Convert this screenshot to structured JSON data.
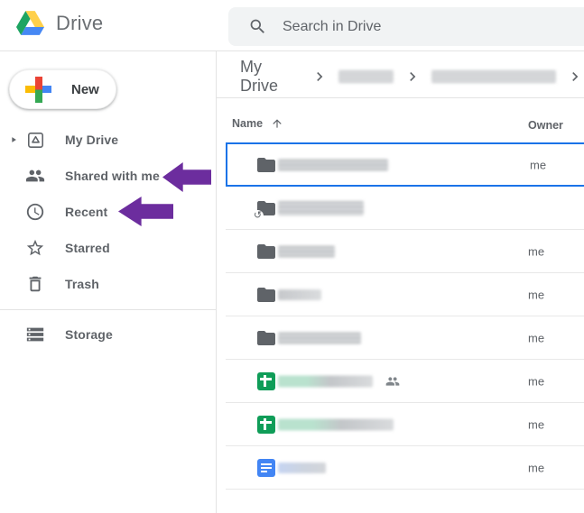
{
  "header": {
    "app_name": "Drive",
    "search": {
      "placeholder": "Search in Drive"
    }
  },
  "sidebar": {
    "new_button_label": "New",
    "items": [
      {
        "label": "My Drive",
        "icon": "my-drive-icon",
        "expandable": true
      },
      {
        "label": "Shared with me",
        "icon": "people-icon"
      },
      {
        "label": "Recent",
        "icon": "clock-icon"
      },
      {
        "label": "Starred",
        "icon": "star-icon"
      },
      {
        "label": "Trash",
        "icon": "trash-icon"
      }
    ],
    "storage_label": "Storage"
  },
  "breadcrumb": {
    "root": "My Drive",
    "redacted_segment_count": 2
  },
  "table": {
    "name_header": "Name",
    "owner_header": "Owner",
    "sort_direction": "ascending",
    "rows": [
      {
        "type": "folder",
        "owner": "me",
        "selected": true,
        "redacted_name_width": 122,
        "blur_style": "streak"
      },
      {
        "type": "folder",
        "owner": "",
        "syncing": true,
        "redacted_name_width": 95,
        "blur_style": "streak-tall"
      },
      {
        "type": "folder",
        "owner": "me",
        "redacted_name_width": 63,
        "blur_style": "streak"
      },
      {
        "type": "folder",
        "owner": "me",
        "redacted_name_width": 48,
        "blur_style": "soft"
      },
      {
        "type": "folder",
        "owner": "me",
        "redacted_name_width": 92,
        "blur_style": "streak"
      },
      {
        "type": "spreadsheet",
        "owner": "me",
        "shared": true,
        "redacted_name_width": 105,
        "blur_style": "greenish"
      },
      {
        "type": "spreadsheet",
        "owner": "me",
        "redacted_name_width": 128,
        "blur_style": "greenish"
      },
      {
        "type": "document",
        "owner": "me",
        "redacted_name_width": 53,
        "blur_style": "blueish"
      }
    ]
  },
  "annotations": {
    "color": "#6C2D9E",
    "arrows": [
      {
        "points_at": "Shared with me"
      },
      {
        "points_at": "Recent"
      }
    ]
  },
  "colors": {
    "accent_blue": "#1a73e8",
    "icon_gray": "#5f6368",
    "sheets_green": "#0f9d58",
    "docs_blue": "#4285f4",
    "logo_green": "#1da462",
    "logo_yellow": "#ffd04b",
    "logo_blue": "#4688f4",
    "plus_red": "#ea4335",
    "plus_green": "#34a853",
    "plus_yellow": "#fbbc04",
    "plus_blue": "#4285f4"
  }
}
